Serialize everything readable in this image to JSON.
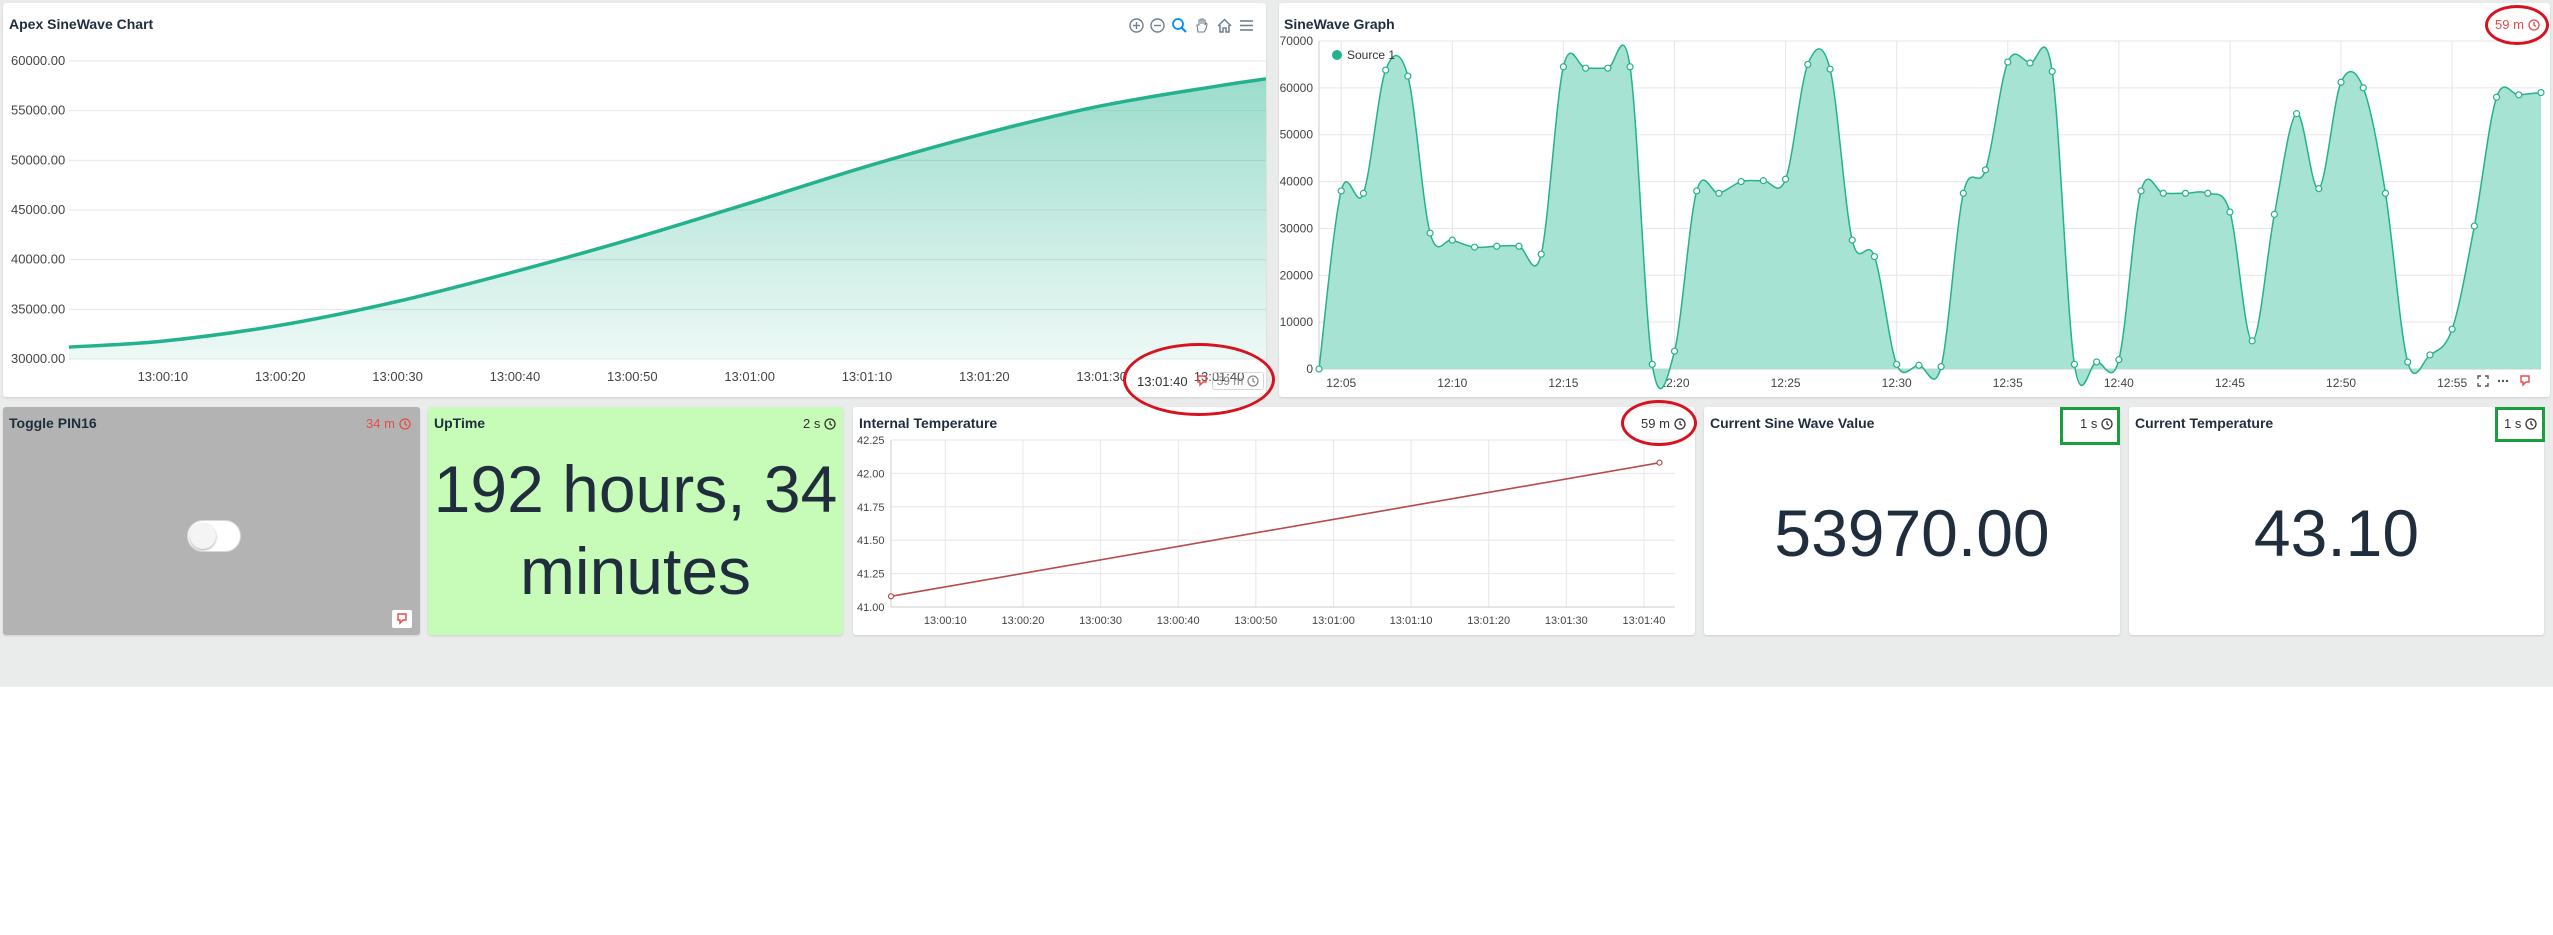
{
  "colors": {
    "teal": "#23b28e",
    "teal_fill": "#a6e3d2",
    "uptime_bg": "#c7fbb8",
    "toggle_bg": "#b3b3b3",
    "alert_red": "#e84a4a",
    "temp_line": "#b84a4a",
    "annotation_red": "#d8121e",
    "annotation_green": "#1a9e3f"
  },
  "apex": {
    "title": "Apex SineWave Chart",
    "toolbar_icons": [
      "zoom-in-icon",
      "zoom-out-icon",
      "selection-zoom-icon",
      "pan-icon",
      "home-icon",
      "menu-icon"
    ],
    "timestamp": "13:01:40",
    "age": "59 m"
  },
  "sinegraph": {
    "title": "SineWave Graph",
    "age": "59 m"
  },
  "toggle_card": {
    "title": "Toggle PIN16",
    "age": "34 m",
    "state_on": false
  },
  "uptime": {
    "title": "UpTime",
    "age": "2 s",
    "value_line1": "192 hours, 34",
    "value_line2": "minutes"
  },
  "temp_chart": {
    "title": "Internal Temperature",
    "age": "59 m"
  },
  "sine_value": {
    "title": "Current Sine Wave Value",
    "age": "1 s",
    "value": "53970.00"
  },
  "cur_temp": {
    "title": "Current Temperature",
    "age": "1 s",
    "value": "43.10"
  },
  "chart_data": [
    {
      "type": "area",
      "title": "Apex SineWave Chart",
      "xlabel": "",
      "ylabel": "",
      "x_ticks": [
        "13:00:10",
        "13:00:20",
        "13:00:30",
        "13:00:40",
        "13:00:50",
        "13:01:00",
        "13:01:10",
        "13:01:20",
        "13:01:30",
        "13:01:40"
      ],
      "y_ticks": [
        "30000.00",
        "35000.00",
        "40000.00",
        "45000.00",
        "50000.00",
        "55000.00",
        "60000.00"
      ],
      "ylim": [
        30000,
        60000
      ],
      "xlim": [
        "13:00:02",
        "13:01:44"
      ],
      "series": [
        {
          "x": [
            "13:00:02",
            "13:00:10",
            "13:00:20",
            "13:00:30",
            "13:00:40",
            "13:00:50",
            "13:01:00",
            "13:01:10",
            "13:01:20",
            "13:01:30",
            "13:01:40",
            "13:01:44"
          ],
          "values": [
            31200,
            31800,
            33400,
            35800,
            38800,
            42100,
            45700,
            49400,
            52700,
            55500,
            57500,
            58200
          ]
        }
      ],
      "grid": true,
      "legend": "none"
    },
    {
      "type": "area",
      "title": "SineWave Graph",
      "xlabel": "",
      "ylabel": "",
      "x_ticks": [
        "12:05",
        "12:10",
        "12:15",
        "12:20",
        "12:25",
        "12:30",
        "12:35",
        "12:40",
        "12:45",
        "12:50",
        "12:55"
      ],
      "y_ticks": [
        "0",
        "10000",
        "20000",
        "30000",
        "40000",
        "50000",
        "60000",
        "70000"
      ],
      "ylim": [
        0,
        70000
      ],
      "xlim": [
        "12:04",
        "12:59"
      ],
      "series": [
        {
          "name": "Source 1",
          "x": [
            "12:04",
            "12:05",
            "12:06",
            "12:07",
            "12:08",
            "12:09",
            "12:10",
            "12:11",
            "12:12",
            "12:13",
            "12:14",
            "12:15",
            "12:16",
            "12:17",
            "12:18",
            "12:19",
            "12:20",
            "12:21",
            "12:22",
            "12:23",
            "12:24",
            "12:25",
            "12:26",
            "12:27",
            "12:28",
            "12:29",
            "12:30",
            "12:31",
            "12:32",
            "12:33",
            "12:34",
            "12:35",
            "12:36",
            "12:37",
            "12:38",
            "12:39",
            "12:40",
            "12:41",
            "12:42",
            "12:43",
            "12:44",
            "12:45",
            "12:46",
            "12:47",
            "12:48",
            "12:49",
            "12:50",
            "12:51",
            "12:52",
            "12:53",
            "12:54",
            "12:55",
            "12:56",
            "12:57",
            "12:58",
            "12:59"
          ],
          "values": [
            0,
            38000,
            37500,
            63800,
            62500,
            29000,
            27500,
            26000,
            26200,
            26200,
            24500,
            64500,
            64200,
            64200,
            64500,
            1000,
            3800,
            38000,
            37500,
            40000,
            40200,
            40500,
            65000,
            64000,
            27500,
            24000,
            1000,
            800,
            500,
            37500,
            42500,
            65500,
            65300,
            63500,
            1000,
            1500,
            2000,
            38000,
            37500,
            37500,
            37500,
            33500,
            6000,
            33000,
            54500,
            38500,
            61200,
            60000,
            37500,
            1500,
            3000,
            8500,
            30500,
            58000,
            58500,
            59000
          ]
        }
      ],
      "grid": true,
      "legend": "top-left"
    },
    {
      "type": "line",
      "title": "Internal Temperature",
      "xlabel": "",
      "ylabel": "",
      "x_ticks": [
        "13:00:10",
        "13:00:20",
        "13:00:30",
        "13:00:40",
        "13:00:50",
        "13:01:00",
        "13:01:10",
        "13:01:20",
        "13:01:30",
        "13:01:40"
      ],
      "y_ticks": [
        "41.00",
        "41.25",
        "41.50",
        "41.75",
        "42.00",
        "42.25"
      ],
      "ylim": [
        41.0,
        42.25
      ],
      "xlim": [
        "13:00:03",
        "13:01:44"
      ],
      "series": [
        {
          "x": [
            "13:00:03",
            "13:01:42"
          ],
          "values": [
            41.08,
            42.08
          ]
        }
      ],
      "grid": true,
      "legend": "none"
    }
  ]
}
